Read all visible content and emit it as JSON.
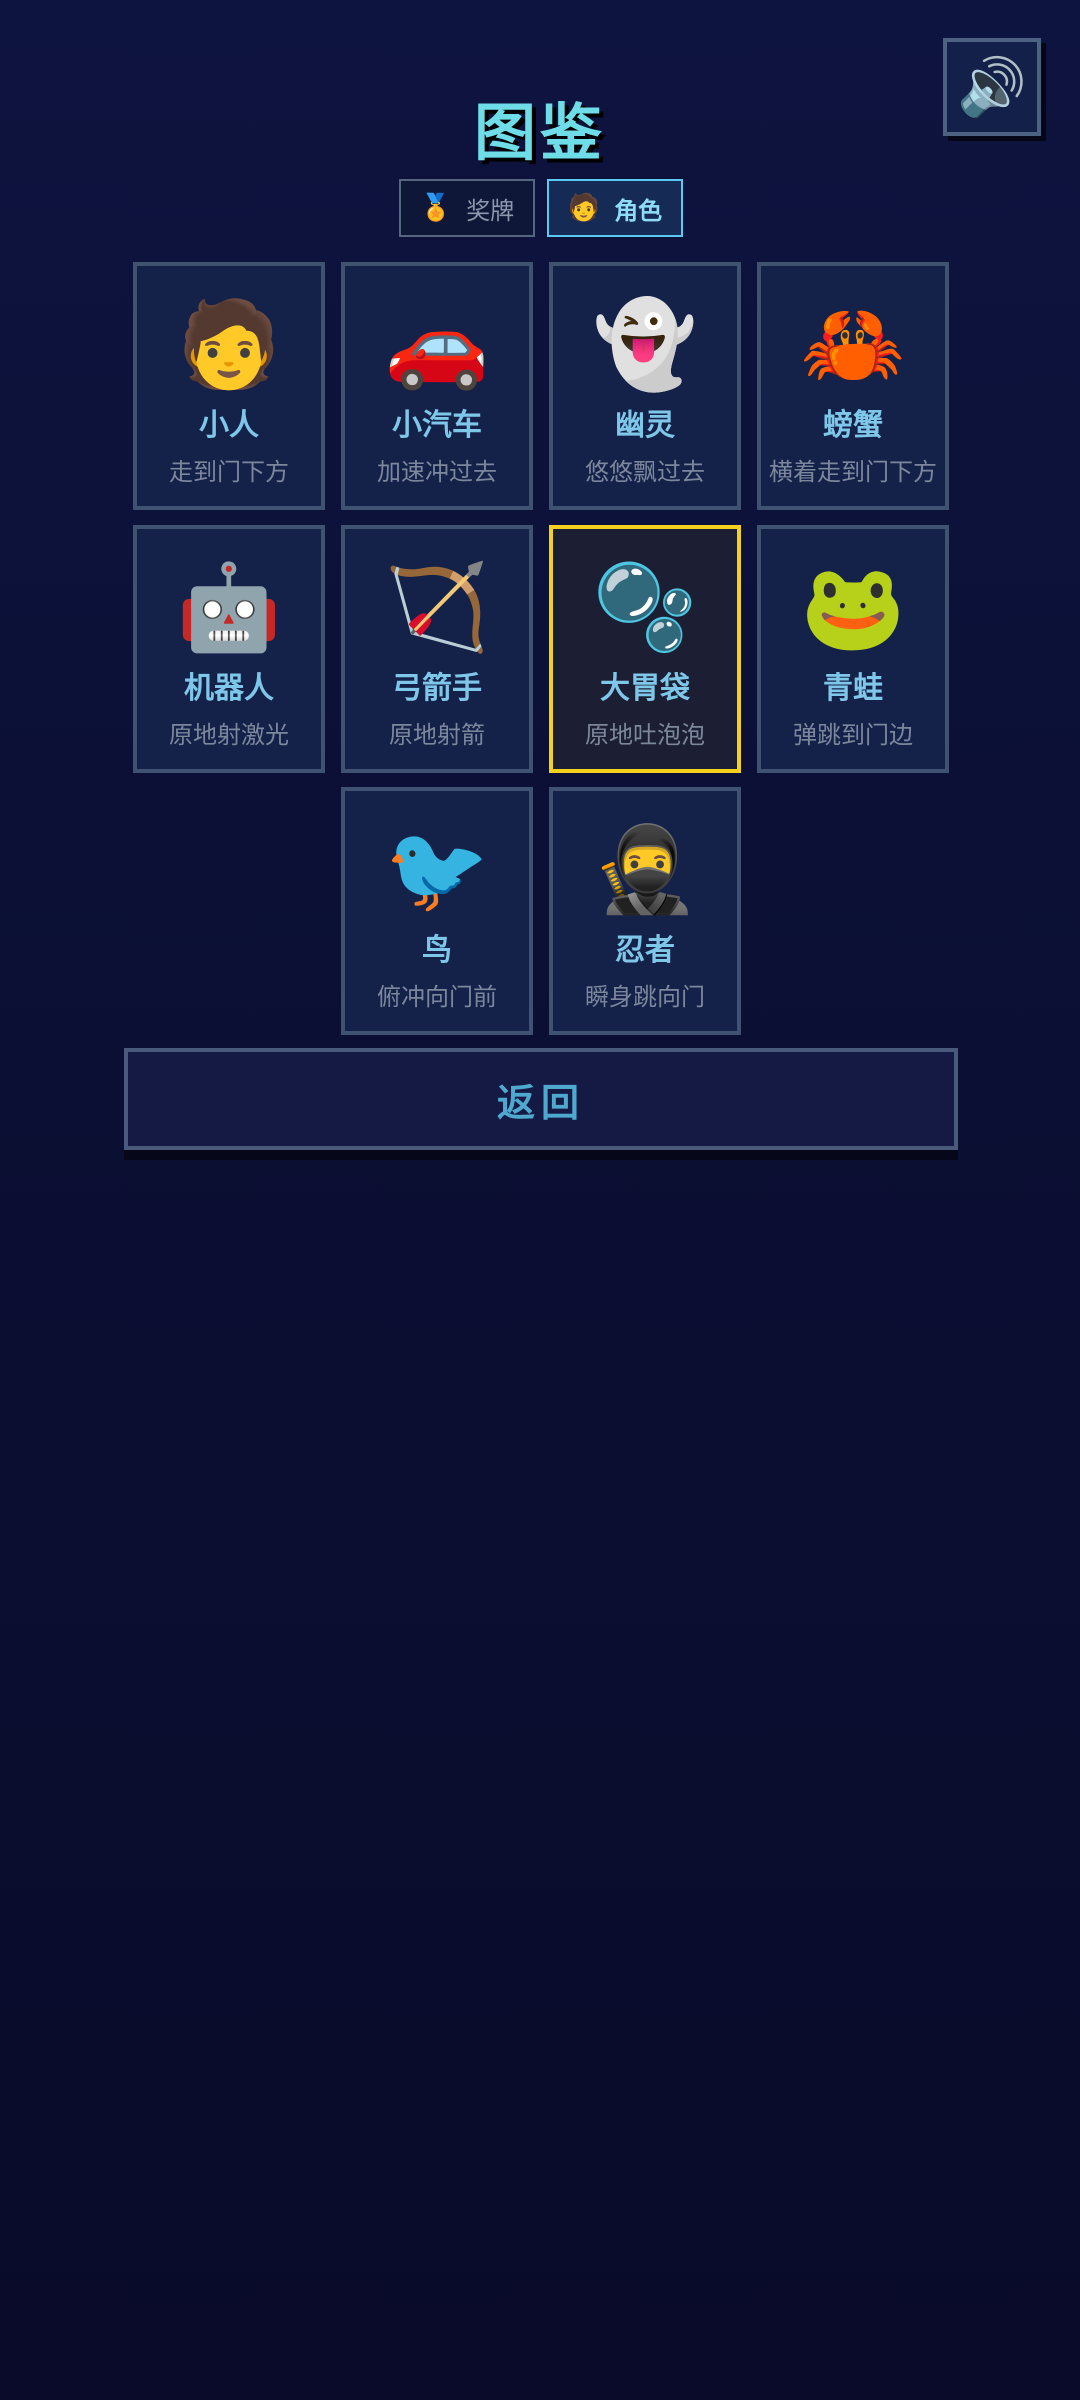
{
  "header": {
    "title": "图鉴",
    "sound_icon": "🔊"
  },
  "tabs": [
    {
      "icon": "🏅",
      "label": "奖牌",
      "active": false
    },
    {
      "icon": "🧑",
      "label": "角色",
      "active": true
    }
  ],
  "characters": [
    {
      "emoji": "🧑",
      "name": "小人",
      "desc": "走到门下方",
      "selected": false
    },
    {
      "emoji": "🚗",
      "name": "小汽车",
      "desc": "加速冲过去",
      "selected": false
    },
    {
      "emoji": "👻",
      "name": "幽灵",
      "desc": "悠悠飘过去",
      "selected": false
    },
    {
      "emoji": "🦀",
      "name": "螃蟹",
      "desc": "横着走到门下方",
      "selected": false
    },
    {
      "emoji": "🤖",
      "name": "机器人",
      "desc": "原地射激光",
      "selected": false
    },
    {
      "emoji": "🏹",
      "name": "弓箭手",
      "desc": "原地射箭",
      "selected": false
    },
    {
      "emoji": "🫧",
      "name": "大胃袋",
      "desc": "原地吐泡泡",
      "selected": true
    },
    {
      "emoji": "🐸",
      "name": "青蛙",
      "desc": "弹跳到门边",
      "selected": false
    },
    {
      "emoji": "🐦",
      "name": "鸟",
      "desc": "俯冲向门前",
      "selected": false
    },
    {
      "emoji": "🥷",
      "name": "忍者",
      "desc": "瞬身跳向门",
      "selected": false
    }
  ],
  "footer": {
    "back_label": "返回"
  },
  "colors": {
    "accent_cyan": "#6fdde8",
    "selected_border": "#f5d11e",
    "background": "#0b0f33"
  }
}
